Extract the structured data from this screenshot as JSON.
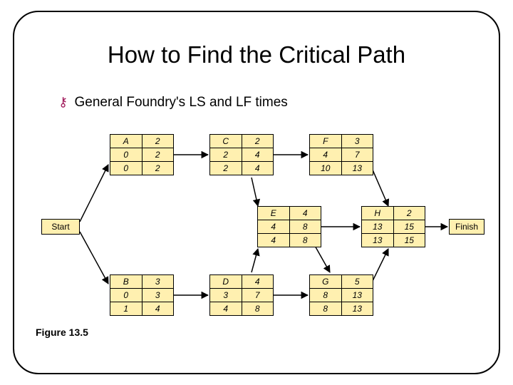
{
  "title": "How to Find the Critical Path",
  "subtitle": "General Foundry's LS and LF times",
  "caption": "Figure 13.5",
  "start_label": "Start",
  "finish_label": "Finish",
  "nodes": {
    "A": {
      "name": "A",
      "dur": "2",
      "es": "0",
      "ef": "2",
      "ls": "0",
      "lf": "2"
    },
    "B": {
      "name": "B",
      "dur": "3",
      "es": "0",
      "ef": "3",
      "ls": "1",
      "lf": "4"
    },
    "C": {
      "name": "C",
      "dur": "2",
      "es": "2",
      "ef": "4",
      "ls": "2",
      "lf": "4"
    },
    "D": {
      "name": "D",
      "dur": "4",
      "es": "3",
      "ef": "7",
      "ls": "4",
      "lf": "8"
    },
    "E": {
      "name": "E",
      "dur": "4",
      "es": "4",
      "ef": "8",
      "ls": "4",
      "lf": "8"
    },
    "F": {
      "name": "F",
      "dur": "3",
      "es": "4",
      "ef": "7",
      "ls": "10",
      "lf": "13"
    },
    "G": {
      "name": "G",
      "dur": "5",
      "es": "8",
      "ef": "13",
      "ls": "8",
      "lf": "13"
    },
    "H": {
      "name": "H",
      "dur": "2",
      "es": "13",
      "ef": "15",
      "ls": "13",
      "lf": "15"
    }
  },
  "chart_data": {
    "type": "graph",
    "title": "General Foundry's LS and LF times",
    "nodes": [
      "Start",
      "A",
      "B",
      "C",
      "D",
      "E",
      "F",
      "G",
      "H",
      "Finish"
    ],
    "edges": [
      [
        "Start",
        "A"
      ],
      [
        "Start",
        "B"
      ],
      [
        "A",
        "C"
      ],
      [
        "C",
        "F"
      ],
      [
        "C",
        "E"
      ],
      [
        "B",
        "D"
      ],
      [
        "D",
        "E"
      ],
      [
        "D",
        "G"
      ],
      [
        "E",
        "G"
      ],
      [
        "E",
        "H"
      ],
      [
        "F",
        "H"
      ],
      [
        "G",
        "H"
      ],
      [
        "H",
        "Finish"
      ]
    ],
    "activity_data": [
      {
        "id": "A",
        "duration": 2,
        "ES": 0,
        "EF": 2,
        "LS": 0,
        "LF": 2
      },
      {
        "id": "B",
        "duration": 3,
        "ES": 0,
        "EF": 3,
        "LS": 1,
        "LF": 4
      },
      {
        "id": "C",
        "duration": 2,
        "ES": 2,
        "EF": 4,
        "LS": 2,
        "LF": 4
      },
      {
        "id": "D",
        "duration": 4,
        "ES": 3,
        "EF": 7,
        "LS": 4,
        "LF": 8
      },
      {
        "id": "E",
        "duration": 4,
        "ES": 4,
        "EF": 8,
        "LS": 4,
        "LF": 8
      },
      {
        "id": "F",
        "duration": 3,
        "ES": 4,
        "EF": 7,
        "LS": 10,
        "LF": 13
      },
      {
        "id": "G",
        "duration": 5,
        "ES": 8,
        "EF": 13,
        "LS": 8,
        "LF": 13
      },
      {
        "id": "H",
        "duration": 2,
        "ES": 13,
        "EF": 15,
        "LS": 13,
        "LF": 15
      }
    ]
  }
}
